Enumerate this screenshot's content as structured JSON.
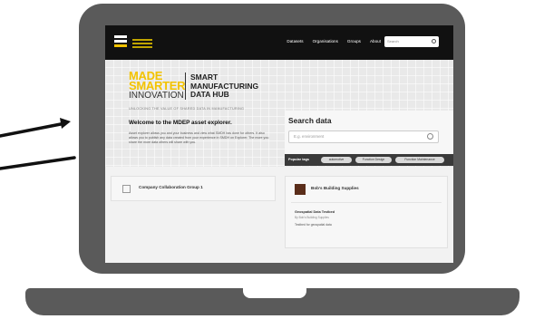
{
  "nav": {
    "links": [
      "Datasets",
      "Organisations",
      "Groups",
      "About"
    ],
    "search_placeholder": "Search"
  },
  "brand": {
    "made": "MADE",
    "smarter": "SMARTER",
    "innovation": "INNOVATION",
    "right_line1": "SMART",
    "right_line2": "MANUFACTURING",
    "right_line3": "DATA HUB",
    "tagline": "UNLOCKING THE VALUE OF SHARED DATA IN MANUFACTURING"
  },
  "welcome": {
    "title": "Welcome to the MDEP asset explorer.",
    "text": "Asset explorer allows you and your business and view what SMDH has done for others. It also allows you to publish any data created from your experience in SMDH on Explorer. The more you share the more data others will share with you."
  },
  "search": {
    "title": "Search data",
    "placeholder": "E.g. environment"
  },
  "tags": {
    "label": "Popular tags",
    "items": [
      "automotive",
      "Function Design",
      "Function Maintenance"
    ]
  },
  "group_card": {
    "title": "Company Collaboration Group 1"
  },
  "org_card": {
    "org_name": "Bob's Building Supplies",
    "dataset_title": "Geospatial Data Testbed",
    "dataset_by": "By Bob's Building Supplies",
    "dataset_desc": "Testbed for geospatial data"
  },
  "colors": {
    "brand_yellow": "#f3c300",
    "laptop_frame": "#5a5a5a",
    "nav_bg": "#111111"
  }
}
